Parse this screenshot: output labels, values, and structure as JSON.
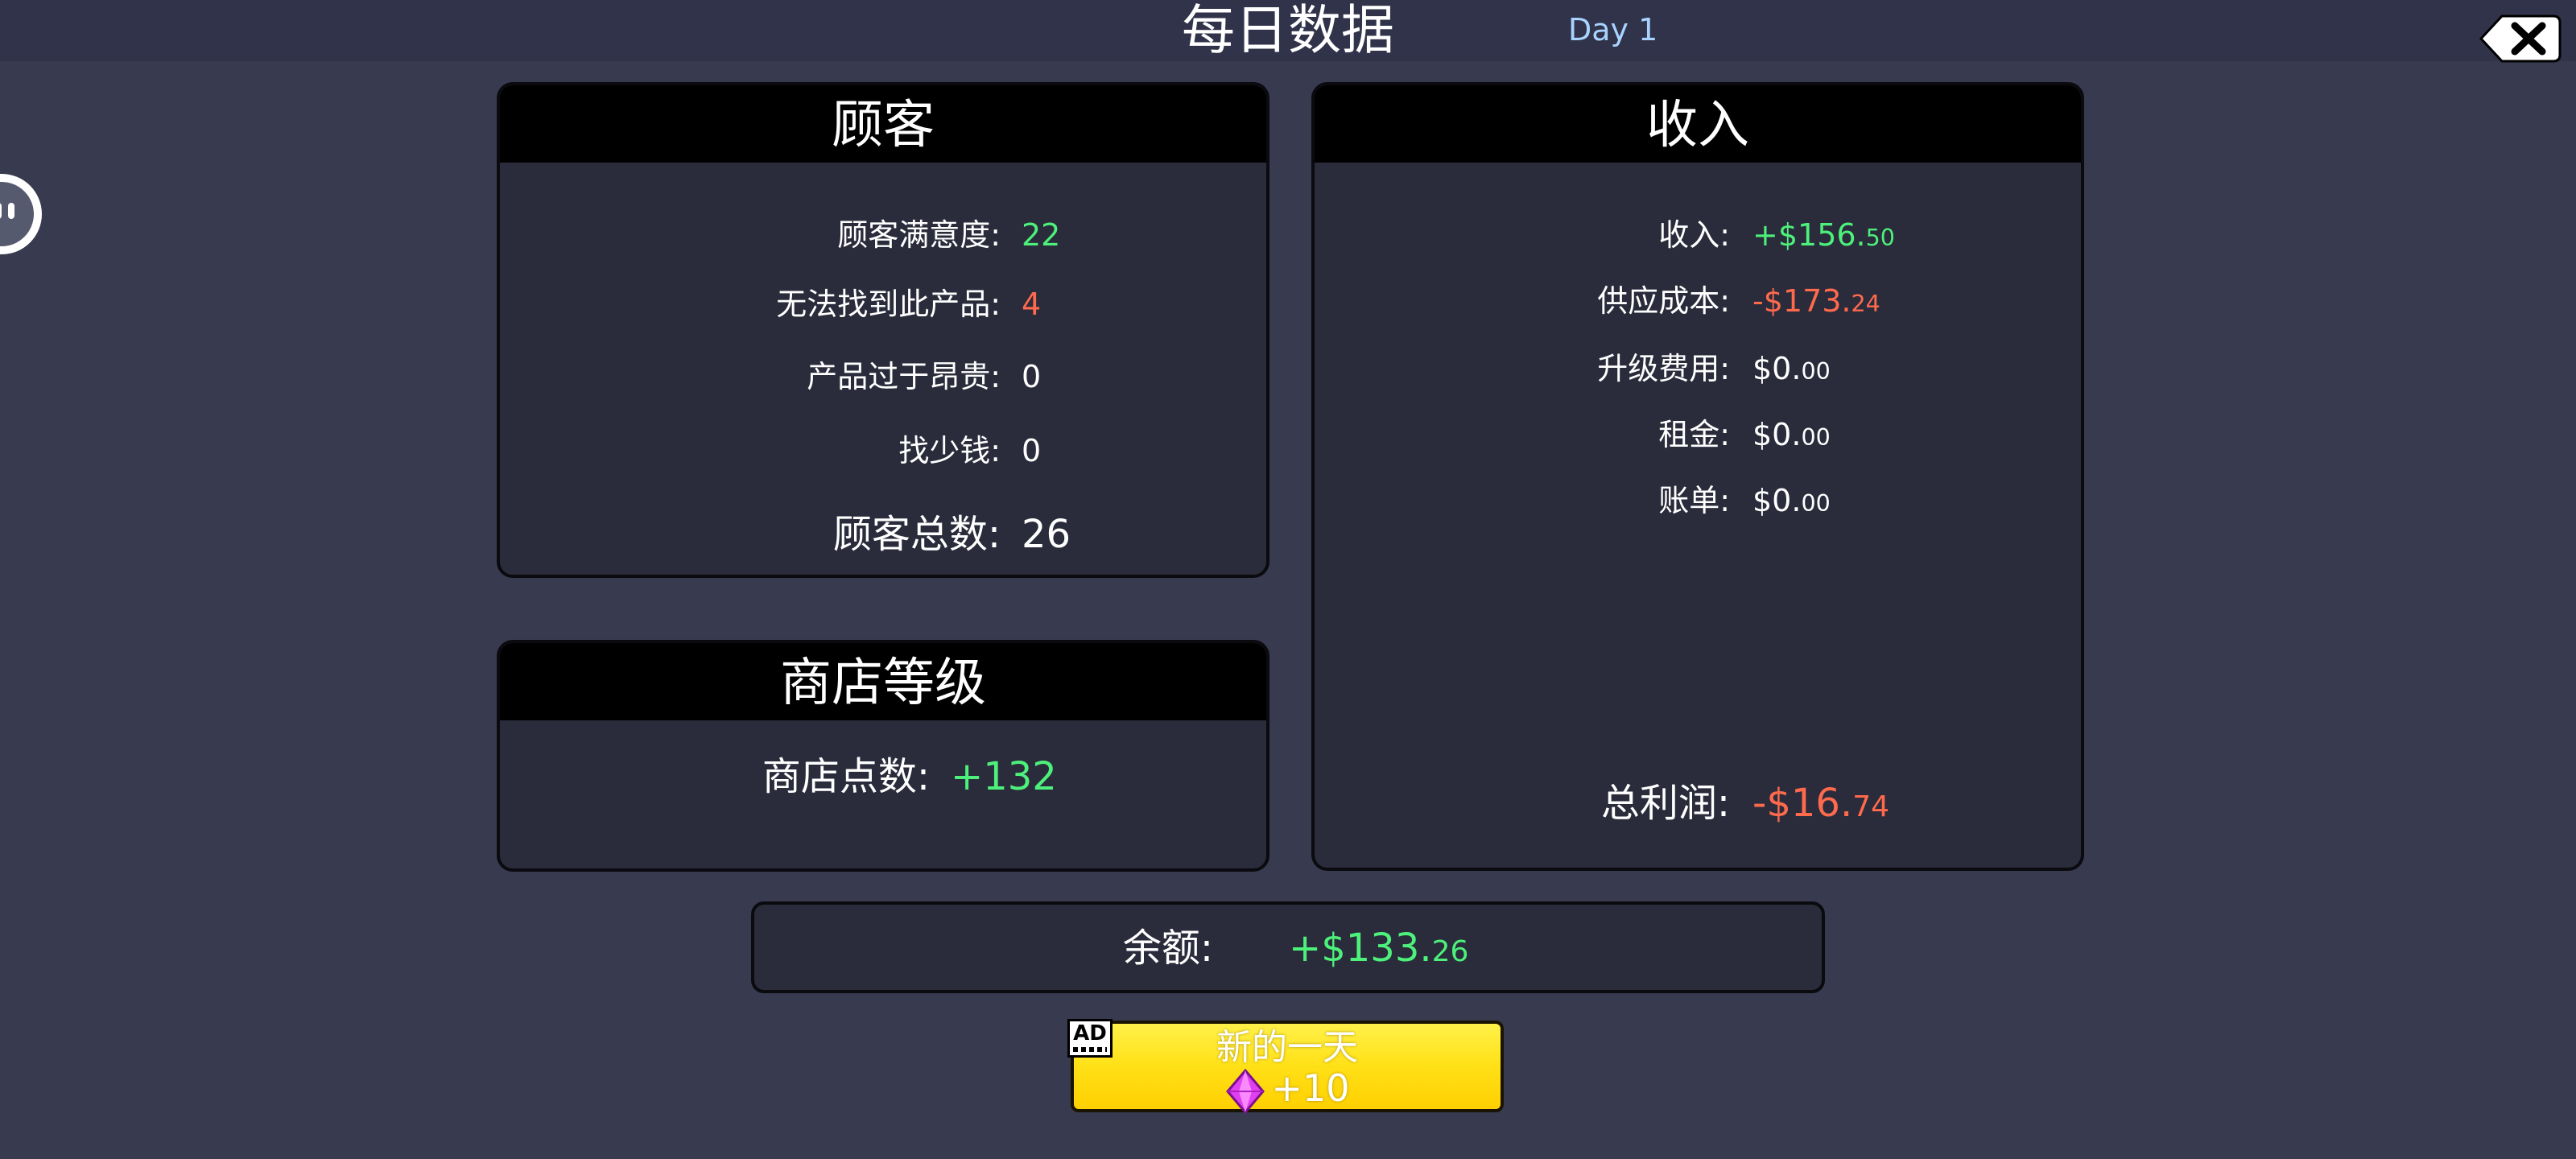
{
  "header": {
    "title": "每日数据",
    "day": "Day 1"
  },
  "icons": {
    "close": "close-icon",
    "side_handle": "face-icon",
    "gem": "gem-icon",
    "ad": "ad-badge-icon"
  },
  "customers": {
    "title": "顾客",
    "rows": [
      {
        "label": "顾客满意度:",
        "value": "22",
        "color": "#4df07a"
      },
      {
        "label": "无法找到此产品:",
        "value": "4",
        "color": "#ff6a4d"
      },
      {
        "label": "产品过于昂贵:",
        "value": "0",
        "color": "#ffffff"
      },
      {
        "label": "找少钱:",
        "value": "0",
        "color": "#ffffff"
      }
    ],
    "total": {
      "label": "顾客总数:",
      "value": "26"
    }
  },
  "store_level": {
    "title": "商店等级",
    "points": {
      "label": "商店点数:",
      "value": "+132"
    }
  },
  "income": {
    "title": "收入",
    "rows": [
      {
        "label": "收入:",
        "value_main": "+$156.",
        "value_cents": "50",
        "color": "#4df07a"
      },
      {
        "label": "供应成本:",
        "value_main": "-$173.",
        "value_cents": "24",
        "color": "#ff6a4d"
      },
      {
        "label": "升级费用:",
        "value_main": "$0.",
        "value_cents": "00",
        "color": "#ffffff"
      },
      {
        "label": "租金:",
        "value_main": "$0.",
        "value_cents": "00",
        "color": "#ffffff"
      },
      {
        "label": "账单:",
        "value_main": "$0.",
        "value_cents": "00",
        "color": "#ffffff"
      }
    ],
    "profit": {
      "label": "总利润:",
      "value_main": "-$16.",
      "value_cents": "74"
    }
  },
  "balance": {
    "label": "余额:",
    "value_main": "+$133.",
    "value_cents": "26"
  },
  "new_day": {
    "label": "新的一天",
    "ad_text": "AD",
    "reward": "+10"
  },
  "colors": {
    "background": "#383b4f",
    "panel": "#2a2b3b",
    "positive": "#4df07a",
    "negative": "#ff6a4d",
    "button": "#ffdd1a",
    "day_text": "#a9d3ff"
  }
}
